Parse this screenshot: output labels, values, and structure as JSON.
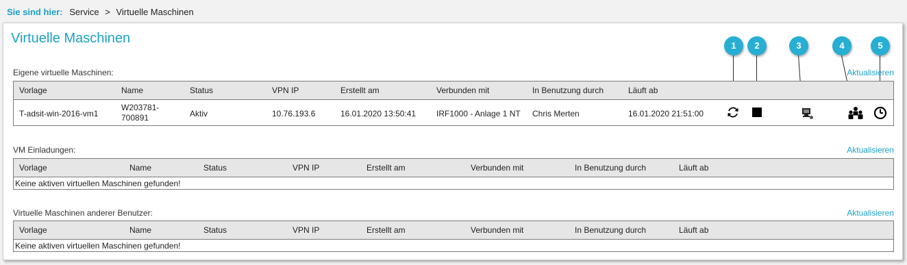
{
  "breadcrumb": {
    "label": "Sie sind hier:",
    "items": [
      "Service",
      ">",
      "Virtuelle Maschinen"
    ]
  },
  "page_title": "Virtuelle Maschinen",
  "refresh_label": "Aktualisieren",
  "empty_message": "Keine aktiven virtuellen Maschinen gefunden!",
  "columns": [
    "Vorlage",
    "Name",
    "Status",
    "VPN IP",
    "Erstellt am",
    "Verbunden mit",
    "In Benutzung durch",
    "Läuft ab"
  ],
  "own_vms": {
    "title": "Eigene virtuelle Maschinen:",
    "rows": [
      {
        "vorlage": "T-adsit-win-2016-vm1",
        "name_line1": "W203781-",
        "name_line2": "700891",
        "status": "Aktiv",
        "vpn_ip": "10.76.193.6",
        "erstellt": "16.01.2020 13:50:41",
        "verbunden": "IRF1000 - Anlage 1 NT",
        "benutzung": "Chris Merten",
        "laeuft_ab": "16.01.2020 21:51:00"
      }
    ]
  },
  "invitations": {
    "title": "VM Einladungen:"
  },
  "other_users": {
    "title": "Virtuelle Maschinen anderer Benutzer:"
  },
  "callouts": [
    "1",
    "2",
    "3",
    "4",
    "5"
  ],
  "icons": [
    "refresh-icon",
    "stop-icon",
    "remote-desktop-icon",
    "users-icon",
    "clock-icon"
  ],
  "colors": {
    "accent": "#1ba1c7",
    "badge": "#27aed3"
  }
}
